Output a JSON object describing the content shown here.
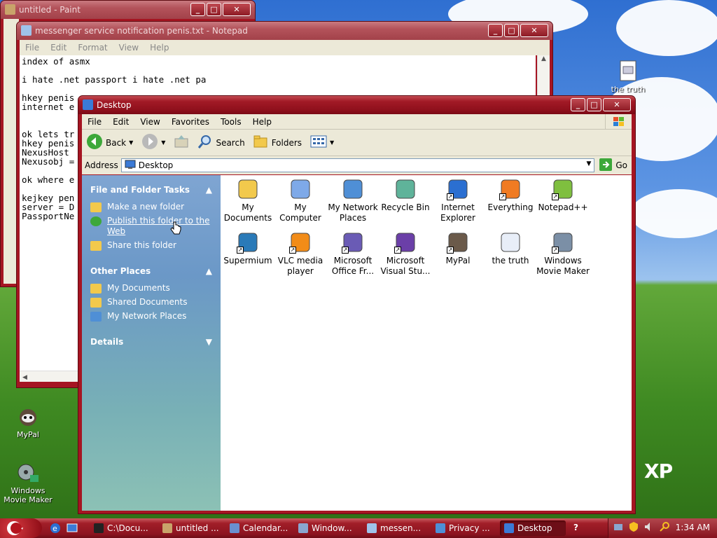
{
  "paint": {
    "title": "untitled - Paint"
  },
  "notepad": {
    "title": "messenger service notification penis.txt - Notepad",
    "menu": [
      "File",
      "Edit",
      "Format",
      "View",
      "Help"
    ],
    "lines": [
      "index of asmx",
      "",
      "i hate .net passport i hate .net pa",
      "",
      "hkey penis",
      "internet e",
      "",
      "",
      "ok lets tr",
      "hkey penis",
      "NexusHost",
      "Nexusobj =",
      "",
      "ok where e",
      "",
      "kejkey pen",
      "server = D",
      "PassportNe"
    ]
  },
  "explorer": {
    "title": "Desktop",
    "menu": [
      "File",
      "Edit",
      "View",
      "Favorites",
      "Tools",
      "Help"
    ],
    "toolbar": {
      "back": "Back",
      "search": "Search",
      "folders": "Folders"
    },
    "address": {
      "label": "Address",
      "value": "Desktop",
      "go": "Go"
    },
    "tasks": {
      "heading": "File and Folder Tasks",
      "items": [
        "Make a new folder",
        "Publish this folder to the Web",
        "Share this folder"
      ]
    },
    "other": {
      "heading": "Other Places",
      "items": [
        "My Documents",
        "Shared Documents",
        "My Network Places"
      ]
    },
    "details": {
      "heading": "Details"
    },
    "files": [
      {
        "name": "My Documents",
        "icon": "folder-docs-icon",
        "color": "#f2c94c"
      },
      {
        "name": "My Computer",
        "icon": "computer-icon",
        "color": "#7ea9e8"
      },
      {
        "name": "My Network Places",
        "icon": "network-icon",
        "color": "#4f8fd6"
      },
      {
        "name": "Recycle Bin",
        "icon": "recycle-bin-icon",
        "color": "#5fb39a"
      },
      {
        "name": "Internet Explorer",
        "icon": "internet-explorer-icon",
        "color": "#2b6fd1"
      },
      {
        "name": "Everything",
        "icon": "everything-icon",
        "color": "#f07b22"
      },
      {
        "name": "Notepad++",
        "icon": "notepadpp-icon",
        "color": "#7fbf3f"
      },
      {
        "name": "Supermium",
        "icon": "supermium-icon",
        "color": "#2a7ab8"
      },
      {
        "name": "VLC media player",
        "icon": "vlc-icon",
        "color": "#f28c18"
      },
      {
        "name": "Microsoft Office Fr...",
        "icon": "office-icon",
        "color": "#6a5bb5"
      },
      {
        "name": "Microsoft Visual Stu...",
        "icon": "visual-studio-icon",
        "color": "#6b3fa8"
      },
      {
        "name": "MyPal",
        "icon": "mypal-icon",
        "color": "#6b5a4a"
      },
      {
        "name": "the truth",
        "icon": "text-file-icon",
        "color": "#e8eef8"
      },
      {
        "name": "Windows Movie Maker",
        "icon": "movie-maker-icon",
        "color": "#7b8fa6"
      }
    ]
  },
  "desktop_icons": [
    {
      "name": "the truth",
      "icon": "text-file-icon"
    },
    {
      "name": "MyPal",
      "icon": "mypal-icon"
    },
    {
      "name": "Windows Movie Maker",
      "icon": "movie-maker-icon"
    }
  ],
  "watermark": "XP",
  "taskbar": {
    "items": [
      {
        "label": "C:\\Docu...",
        "icon": "cmd-icon",
        "color": "#222"
      },
      {
        "label": "untitled ...",
        "icon": "paint-icon",
        "color": "#c9a36a"
      },
      {
        "label": "Calendar...",
        "icon": "calendar-icon",
        "color": "#6a8fd0"
      },
      {
        "label": "Window...",
        "icon": "window-icon",
        "color": "#8aa6d0"
      },
      {
        "label": "messen...",
        "icon": "notepad-icon",
        "color": "#9fc3ea"
      },
      {
        "label": "Privacy ...",
        "icon": "privacy-icon",
        "color": "#4e8fd6"
      },
      {
        "label": "Desktop",
        "icon": "desktop-icon",
        "color": "#3b7ad6"
      }
    ],
    "clock": "1:34 AM"
  }
}
